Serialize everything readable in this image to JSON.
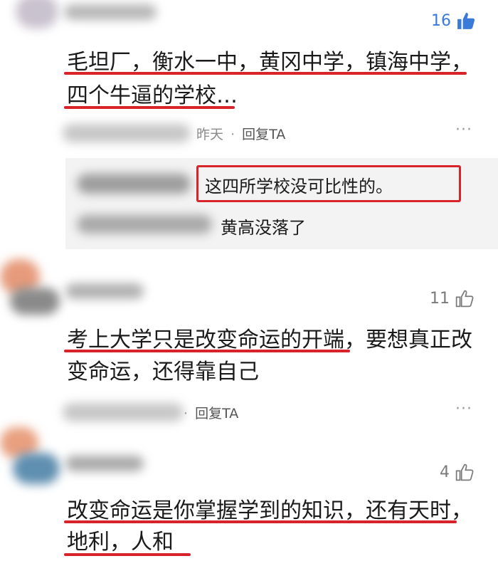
{
  "comments": [
    {
      "likes": "16",
      "liked": true,
      "text_lines": [
        "毛坦厂，衡水一中，黄冈中学，镇海中学，",
        "四个牛逼的学校…"
      ],
      "time": "昨天",
      "separator": "·",
      "reply_label": "回复TA",
      "more": "···",
      "replies": [
        {
          "text": "这四所学校没可比性的。"
        },
        {
          "text": "黄高没落了"
        }
      ]
    },
    {
      "likes": "11",
      "liked": false,
      "text_lines": [
        "考上大学只是改变命运的开端，要想真正改",
        "变命运，还得靠自己"
      ],
      "separator": "·",
      "reply_label": "回复TA",
      "more": "···"
    },
    {
      "likes": "4",
      "liked": false,
      "text_lines": [
        "改变命运是你掌握学到的知识，还有天时，",
        "地利，人和"
      ]
    }
  ],
  "colors": {
    "like_active": "#3a7ad9",
    "underline": "#d8232a",
    "reply_panel_bg": "#f3f3f3"
  },
  "icons": {
    "like": "thumbs-up-icon",
    "more": "more-dots-icon"
  }
}
